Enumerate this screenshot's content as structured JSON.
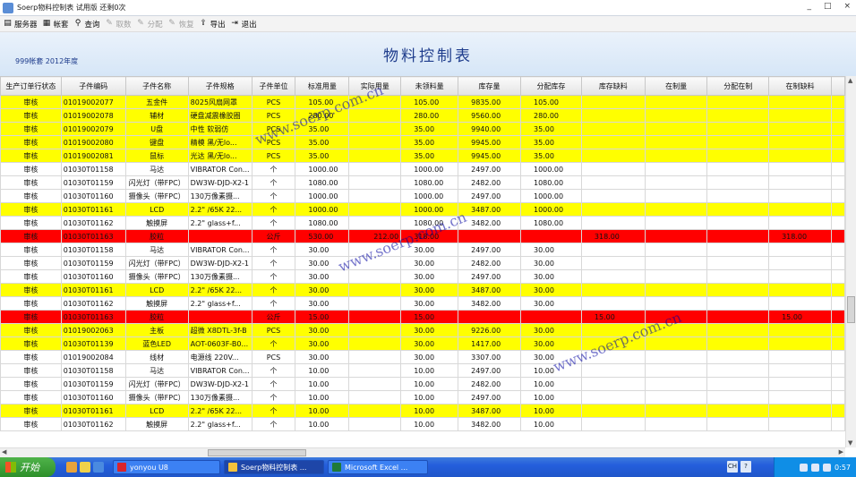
{
  "window": {
    "title": "Soerp物料控制表 试用版 还剩0次",
    "btn_min": "_",
    "btn_max": "□",
    "btn_close": "×"
  },
  "toolbar": [
    {
      "label": "服务器",
      "icon": "server-icon",
      "enabled": true,
      "glyph": "▤"
    },
    {
      "label": "帐套",
      "icon": "book-icon",
      "enabled": true,
      "glyph": "▦"
    },
    {
      "label": "查询",
      "icon": "filter-icon",
      "enabled": true,
      "glyph": "⚲"
    },
    {
      "label": "取数",
      "icon": "fetch-icon",
      "enabled": false,
      "glyph": "✎"
    },
    {
      "label": "分配",
      "icon": "distribute-icon",
      "enabled": false,
      "glyph": "✎"
    },
    {
      "label": "恢复",
      "icon": "restore-icon",
      "enabled": false,
      "glyph": "✎"
    },
    {
      "label": "导出",
      "icon": "export-icon",
      "enabled": true,
      "glyph": "⇪"
    },
    {
      "label": "退出",
      "icon": "exit-icon",
      "enabled": true,
      "glyph": "⇥"
    }
  ],
  "header": {
    "title": "物料控制表",
    "subtitle": "999帐套  2012年度"
  },
  "columns": [
    "生产订单行状态",
    "子件编码",
    "子件名称",
    "子件规格",
    "子件单位",
    "标准用量",
    "实际用量",
    "未领料量",
    "库存量",
    "分配库存",
    "库存缺料",
    "在制量",
    "分配在制",
    "在制缺料"
  ],
  "rows": [
    {
      "style": "yellow",
      "cells": [
        "审核",
        "01019002077",
        "五金件",
        "8025风扇网罩",
        "PCS",
        "105.00",
        "",
        "105.00",
        "9835.00",
        "105.00",
        "",
        "",
        "",
        ""
      ]
    },
    {
      "style": "yellow",
      "cells": [
        "审核",
        "01019002078",
        "辅材",
        "硬盘减震橡胶圈",
        "PCS",
        "280.00",
        "",
        "280.00",
        "9560.00",
        "280.00",
        "",
        "",
        "",
        ""
      ]
    },
    {
      "style": "yellow",
      "cells": [
        "审核",
        "01019002079",
        "U盘",
        "中性 软弱仿",
        "PCS",
        "35.00",
        "",
        "35.00",
        "9940.00",
        "35.00",
        "",
        "",
        "",
        ""
      ]
    },
    {
      "style": "yellow",
      "cells": [
        "审核",
        "01019002080",
        "键盘",
        "精模 黑/无lo...",
        "PCS",
        "35.00",
        "",
        "35.00",
        "9945.00",
        "35.00",
        "",
        "",
        "",
        ""
      ]
    },
    {
      "style": "yellow",
      "cells": [
        "审核",
        "01019002081",
        "鼠标",
        "光达 黑/无lo...",
        "PCS",
        "35.00",
        "",
        "35.00",
        "9945.00",
        "35.00",
        "",
        "",
        "",
        ""
      ]
    },
    {
      "style": "white",
      "cells": [
        "审核",
        "01030T01158",
        "马达",
        "VIBRATOR Con...",
        "个",
        "1000.00",
        "",
        "1000.00",
        "2497.00",
        "1000.00",
        "",
        "",
        "",
        ""
      ]
    },
    {
      "style": "white",
      "cells": [
        "审核",
        "01030T01159",
        "闪光灯（带FPC）",
        "DW3W-DJD-X2-1",
        "个",
        "1080.00",
        "",
        "1080.00",
        "2482.00",
        "1080.00",
        "",
        "",
        "",
        ""
      ]
    },
    {
      "style": "white",
      "cells": [
        "审核",
        "01030T01160",
        "摄像头（带FPC）",
        "130万像素摄...",
        "个",
        "1000.00",
        "",
        "1000.00",
        "2497.00",
        "1000.00",
        "",
        "",
        "",
        ""
      ]
    },
    {
      "style": "yellow",
      "cells": [
        "审核",
        "01030T01161",
        "LCD",
        "2.2\" /65K 22...",
        "个",
        "1000.00",
        "",
        "1000.00",
        "3487.00",
        "1000.00",
        "",
        "",
        "",
        ""
      ]
    },
    {
      "style": "white",
      "cells": [
        "审核",
        "01030T01162",
        "触摸屏",
        "2.2\" glass+f...",
        "个",
        "1080.00",
        "",
        "1080.00",
        "3482.00",
        "1080.00",
        "",
        "",
        "",
        ""
      ]
    },
    {
      "style": "red",
      "cells": [
        "审核",
        "01030T01163",
        "胶粒",
        "",
        "公斤",
        "530.00",
        "212.00",
        "318.00",
        "",
        "",
        "318.00",
        "",
        "",
        "318.00"
      ]
    },
    {
      "style": "white",
      "cells": [
        "审核",
        "01030T01158",
        "马达",
        "VIBRATOR Con...",
        "个",
        "30.00",
        "",
        "30.00",
        "2497.00",
        "30.00",
        "",
        "",
        "",
        ""
      ]
    },
    {
      "style": "white",
      "cells": [
        "审核",
        "01030T01159",
        "闪光灯（带FPC）",
        "DW3W-DJD-X2-1",
        "个",
        "30.00",
        "",
        "30.00",
        "2482.00",
        "30.00",
        "",
        "",
        "",
        ""
      ]
    },
    {
      "style": "white",
      "cells": [
        "审核",
        "01030T01160",
        "摄像头（带FPC）",
        "130万像素摄...",
        "个",
        "30.00",
        "",
        "30.00",
        "2497.00",
        "30.00",
        "",
        "",
        "",
        ""
      ]
    },
    {
      "style": "yellow",
      "cells": [
        "审核",
        "01030T01161",
        "LCD",
        "2.2\" /65K 22...",
        "个",
        "30.00",
        "",
        "30.00",
        "3487.00",
        "30.00",
        "",
        "",
        "",
        ""
      ]
    },
    {
      "style": "white",
      "cells": [
        "审核",
        "01030T01162",
        "触摸屏",
        "2.2\" glass+f...",
        "个",
        "30.00",
        "",
        "30.00",
        "3482.00",
        "30.00",
        "",
        "",
        "",
        ""
      ]
    },
    {
      "style": "red",
      "cells": [
        "审核",
        "01030T01163",
        "胶粒",
        "",
        "公斤",
        "15.00",
        "",
        "15.00",
        "",
        "",
        "15.00",
        "",
        "",
        "15.00"
      ]
    },
    {
      "style": "yellow",
      "cells": [
        "审核",
        "01019002063",
        "主板",
        "超微 X8DTL-3f-B",
        "PCS",
        "30.00",
        "",
        "30.00",
        "9226.00",
        "30.00",
        "",
        "",
        "",
        ""
      ]
    },
    {
      "style": "yellow",
      "cells": [
        "审核",
        "01030T01139",
        "蓝色LED",
        "AOT-0603F-B0...",
        "个",
        "30.00",
        "",
        "30.00",
        "1417.00",
        "30.00",
        "",
        "",
        "",
        ""
      ]
    },
    {
      "style": "white",
      "cells": [
        "审核",
        "01019002084",
        "线材",
        "电源线 220V...",
        "PCS",
        "30.00",
        "",
        "30.00",
        "3307.00",
        "30.00",
        "",
        "",
        "",
        ""
      ]
    },
    {
      "style": "white",
      "cells": [
        "审核",
        "01030T01158",
        "马达",
        "VIBRATOR Con...",
        "个",
        "10.00",
        "",
        "10.00",
        "2497.00",
        "10.00",
        "",
        "",
        "",
        ""
      ]
    },
    {
      "style": "white",
      "cells": [
        "审核",
        "01030T01159",
        "闪光灯（带FPC）",
        "DW3W-DJD-X2-1",
        "个",
        "10.00",
        "",
        "10.00",
        "2482.00",
        "10.00",
        "",
        "",
        "",
        ""
      ]
    },
    {
      "style": "white",
      "cells": [
        "审核",
        "01030T01160",
        "摄像头（带FPC）",
        "130万像素摄...",
        "个",
        "10.00",
        "",
        "10.00",
        "2497.00",
        "10.00",
        "",
        "",
        "",
        ""
      ]
    },
    {
      "style": "yellow",
      "cells": [
        "审核",
        "01030T01161",
        "LCD",
        "2.2\" /65K 22...",
        "个",
        "10.00",
        "",
        "10.00",
        "3487.00",
        "10.00",
        "",
        "",
        "",
        ""
      ]
    },
    {
      "style": "white",
      "cells": [
        "审核",
        "01030T01162",
        "触摸屏",
        "2.2\" glass+f...",
        "个",
        "10.00",
        "",
        "10.00",
        "3482.00",
        "10.00",
        "",
        "",
        "",
        ""
      ]
    }
  ],
  "watermark": [
    "www.soerp.com.cn",
    "www.soerp.com.cn",
    "www.soerp.com.cn"
  ],
  "taskbar": {
    "start": "开始",
    "tasks": [
      {
        "label": "yonyou U8",
        "icon_color": "#d9242b"
      },
      {
        "label": "Soerp物料控制表 ...",
        "icon_color": "#f3c23c",
        "active": true
      },
      {
        "label": "Microsoft Excel ...",
        "icon_color": "#1f7a3a"
      }
    ],
    "lang": [
      "CH",
      "?"
    ],
    "clock": "0:57"
  }
}
